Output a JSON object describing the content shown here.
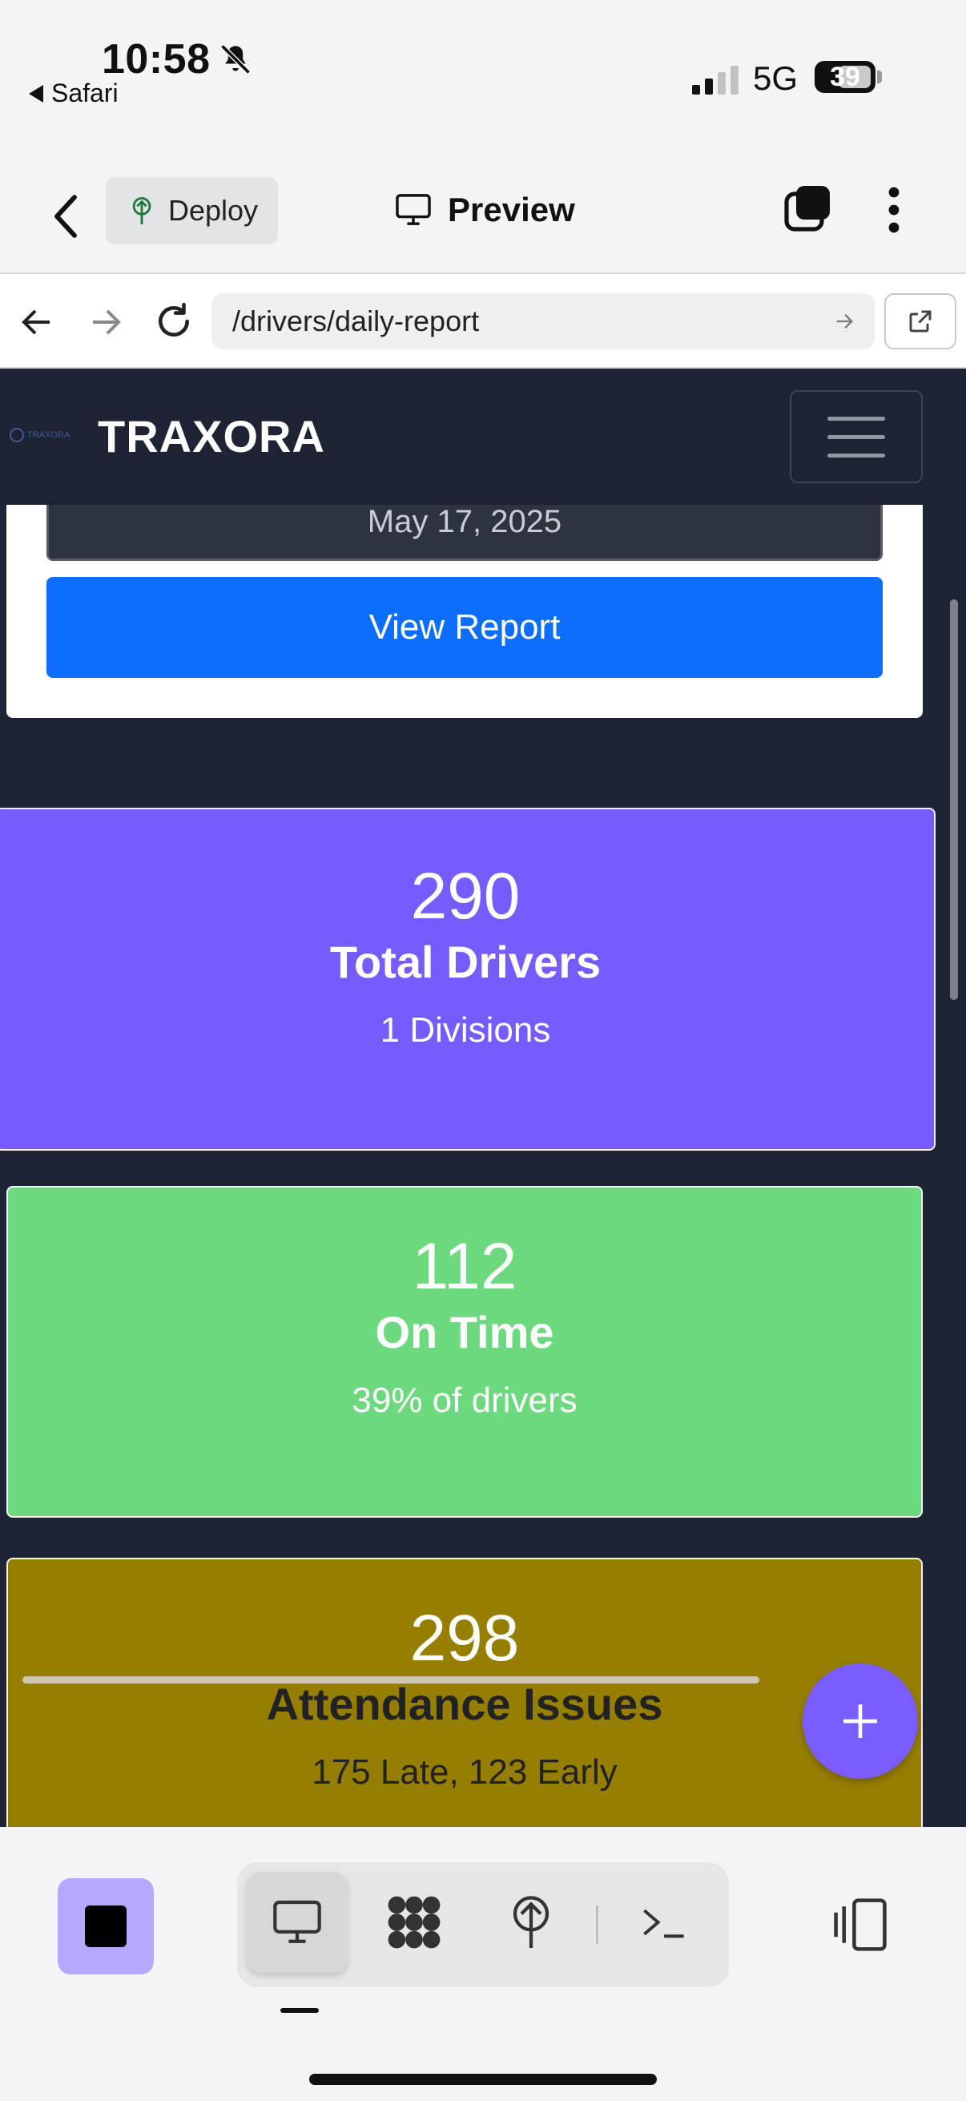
{
  "status_bar": {
    "time": "10:58",
    "back_app": "Safari",
    "network": "5G",
    "battery": "39",
    "signal_bars_filled": 2,
    "signal_bars_total": 4
  },
  "app_bar": {
    "deploy_label": "Deploy",
    "preview_label": "Preview"
  },
  "browser": {
    "url": "/drivers/daily-report"
  },
  "site": {
    "brand": "TRAXORA",
    "logo_text": "TRAXORA",
    "date_value": "May 17, 2025",
    "view_report_label": "View Report"
  },
  "stats": {
    "total": {
      "value": "290",
      "label": "Total Drivers",
      "sub": "1 Divisions"
    },
    "on_time": {
      "value": "112",
      "label": "On Time",
      "sub": "39% of drivers"
    },
    "issues": {
      "value": "298",
      "label": "Attendance Issues",
      "sub": "175 Late, 123 Early"
    }
  },
  "colors": {
    "nav_bg": "#1e2433",
    "primary_button": "#0d6efd",
    "total_card": "#765cff",
    "on_time_card": "#6dd97e",
    "issues_card": "#967f00",
    "fab": "#7b5cff",
    "stop_button": "#b7a8ff"
  },
  "icons": {
    "bell": "bell-slash-icon",
    "deploy": "deploy-tree-icon",
    "preview": "monitor-icon",
    "tabs": "tabs-icon",
    "more": "more-vertical-icon",
    "reload": "reload-icon",
    "external": "open-external-icon",
    "menu": "hamburger-icon",
    "fab": "plus-icon",
    "workspace_tools": [
      "monitor-icon",
      "apps-icon",
      "deploy-tree-icon",
      "terminal-icon"
    ],
    "split": "split-view-icon"
  }
}
